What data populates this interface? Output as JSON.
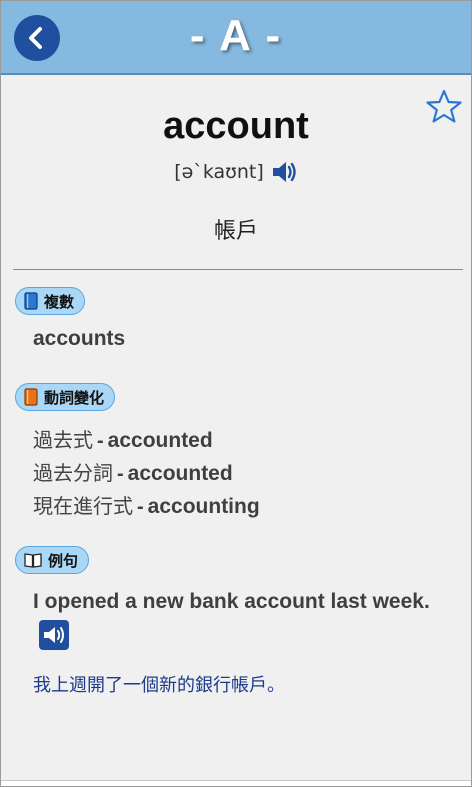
{
  "header": {
    "title": "- A -",
    "back_icon": "chevron-left-icon"
  },
  "entry": {
    "word": "account",
    "phonetic": "[ə`kaʊnt]",
    "meaning": "帳戶"
  },
  "plural": {
    "label": "複數",
    "value": "accounts"
  },
  "conjugation": {
    "label": "動詞變化",
    "items": [
      {
        "label": "過去式",
        "sep": "-",
        "form": "accounted"
      },
      {
        "label": "過去分詞",
        "sep": "-",
        "form": "accounted"
      },
      {
        "label": "現在進行式",
        "sep": "-",
        "form": "accounting"
      }
    ]
  },
  "example": {
    "label": "例句",
    "sentence": "I opened a new bank account last week.",
    "translation": "我上週開了一個新的銀行帳戶。"
  },
  "colors": {
    "header_bg": "#86b9df",
    "back_button": "#1f4f9e",
    "badge_bg": "#aad7f5",
    "star": "#2a78d0",
    "translation": "#1a3c8a"
  }
}
